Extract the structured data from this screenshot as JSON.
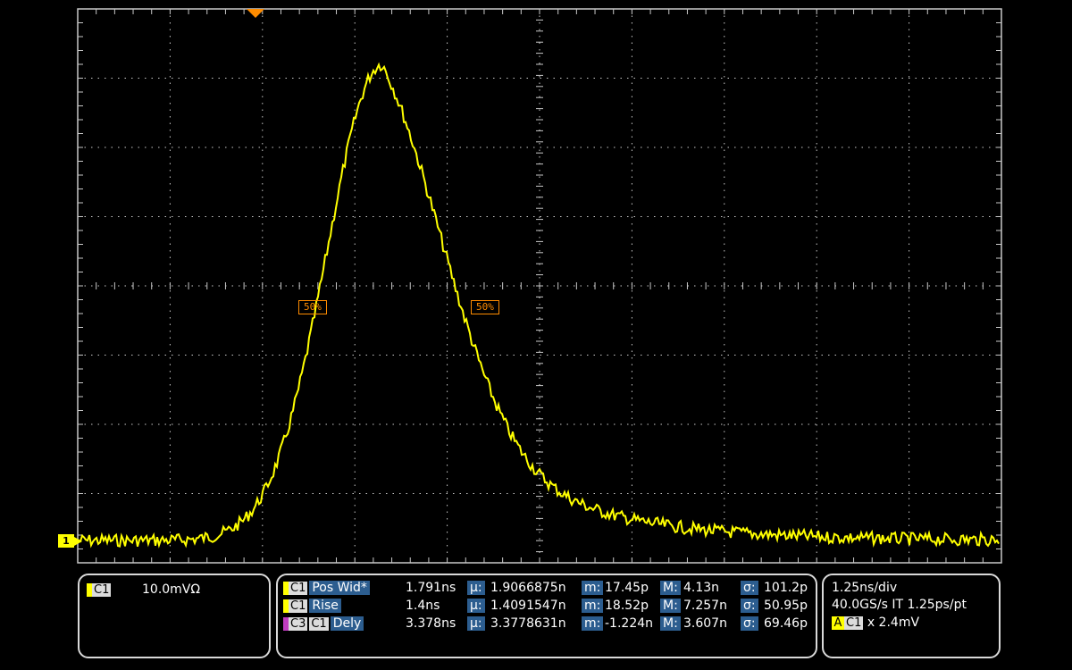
{
  "trace": {
    "color": "#ffff00",
    "grid_color": "#c8c8c8",
    "marker_color": "#ff8c00"
  },
  "channel_marker": "1",
  "cursor_tags": {
    "left": "50%",
    "right": "50%"
  },
  "left_panel": {
    "channel": "C1",
    "scale": "10.0mVΩ"
  },
  "measurements": [
    {
      "channels": [
        "C1"
      ],
      "name": "Pos Wid*",
      "value": "1.791ns",
      "mu": "1.9066875n",
      "m": "17.45p",
      "M": "4.13n",
      "sigma": "101.2p"
    },
    {
      "channels": [
        "C1"
      ],
      "name": "Rise",
      "value": "1.4ns",
      "mu": "1.4091547n",
      "m": "18.52p",
      "M": "7.257n",
      "sigma": "50.95p"
    },
    {
      "channels": [
        "C3",
        "C1"
      ],
      "name": "Dely",
      "value": "3.378ns",
      "mu": "3.3778631n",
      "m": "-1.224n",
      "M": "3.607n",
      "sigma": "69.46p"
    }
  ],
  "stat_labels": {
    "mu": "µ:",
    "m": "m:",
    "M": "M:",
    "sigma": "σ:"
  },
  "right_panel": {
    "timebase": "1.25ns/div",
    "sample": "40.0GS/s IT 1.25ps/pt",
    "trigger_mode": "A",
    "trigger_channel": "C1",
    "trigger_level": "x 2.4mV"
  }
}
